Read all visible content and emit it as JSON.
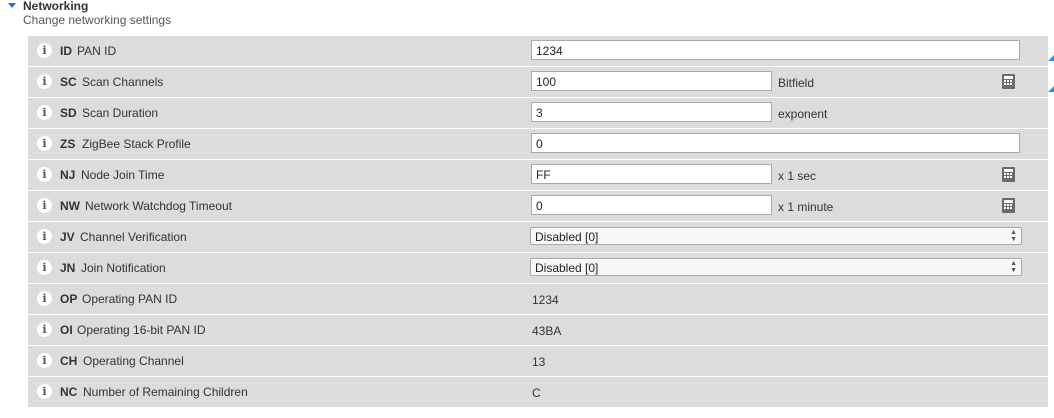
{
  "section": {
    "title": "Networking",
    "subtitle": "Change networking settings"
  },
  "rows": [
    {
      "code": "ID",
      "name": "PAN ID",
      "value": "1234",
      "unit": ""
    },
    {
      "code": "SC",
      "name": "Scan Channels",
      "value": "100",
      "unit": "Bitfield"
    },
    {
      "code": "SD",
      "name": "Scan Duration",
      "value": "3",
      "unit": "exponent"
    },
    {
      "code": "ZS",
      "name": "ZigBee Stack Profile",
      "value": "0",
      "unit": ""
    },
    {
      "code": "NJ",
      "name": "Node Join Time",
      "value": "FF",
      "unit": "x 1 sec"
    },
    {
      "code": "NW",
      "name": "Network Watchdog Timeout",
      "value": "0",
      "unit": "x 1 minute"
    },
    {
      "code": "JV",
      "name": "Channel Verification",
      "value": "Disabled [0]",
      "unit": ""
    },
    {
      "code": "JN",
      "name": "Join Notification",
      "value": "Disabled [0]",
      "unit": ""
    },
    {
      "code": "OP",
      "name": "Operating PAN ID",
      "value": "1234",
      "unit": ""
    },
    {
      "code": "OI",
      "name": "Operating 16-bit PAN ID",
      "value": "43BA",
      "unit": ""
    },
    {
      "code": "CH",
      "name": "Operating Channel",
      "value": "13",
      "unit": ""
    },
    {
      "code": "NC",
      "name": "Number of Remaining Children",
      "value": "C",
      "unit": ""
    }
  ],
  "icons": {
    "info": "info-icon",
    "calculator": "calculator-icon",
    "collapse": "chevron-down-icon"
  },
  "colors": {
    "accent": "#2f8fdc",
    "row_bg": "#dcdcdc"
  }
}
